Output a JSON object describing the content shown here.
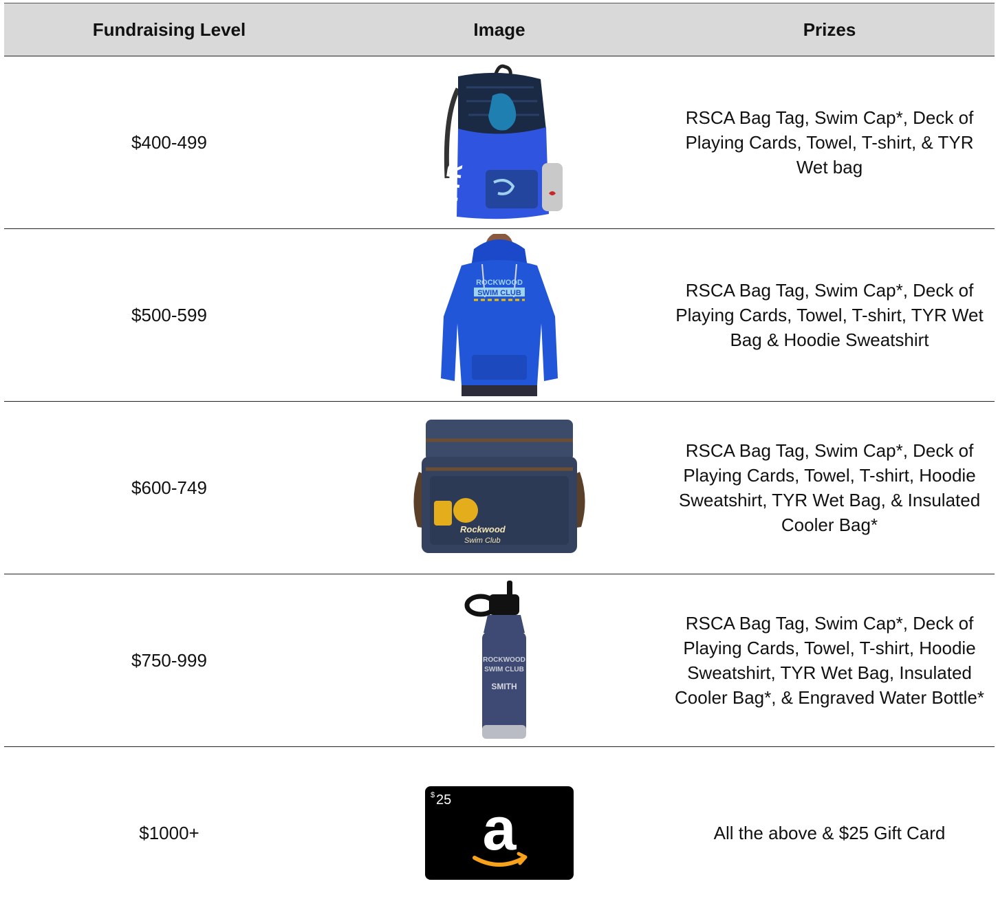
{
  "header": {
    "col_level": "Fundraising Level",
    "col_image": "Image",
    "col_prizes": "Prizes"
  },
  "rows": [
    {
      "level": "$400-499",
      "image": "tyr-mesh-backpack-icon",
      "logo": "TYR",
      "prizes": "RSCA Bag Tag, Swim Cap*, Deck of Playing Cards, Towel, T-shirt, & TYR Wet bag"
    },
    {
      "level": "$500-599",
      "image": "hoodie-sweatshirt-icon",
      "logo_line1": "ROCKWOOD",
      "logo_line2": "SWIM CLUB",
      "prizes": "RSCA Bag Tag, Swim Cap*, Deck of Playing Cards, Towel, T-shirt, TYR Wet Bag & Hoodie Sweatshirt"
    },
    {
      "level": "$600-749",
      "image": "insulated-cooler-bag-icon",
      "logo_line1": "Rockwood",
      "logo_line2": "Swim Club",
      "prizes": "RSCA Bag Tag, Swim Cap*, Deck of Playing Cards, Towel, T-shirt, Hoodie Sweatshirt, TYR Wet Bag, & Insulated Cooler Bag*"
    },
    {
      "level": "$750-999",
      "image": "engraved-water-bottle-icon",
      "logo_line1": "ROCKWOOD",
      "logo_line2": "SWIM CLUB",
      "engraving": "SMITH",
      "prizes": "RSCA Bag Tag, Swim Cap*, Deck of Playing Cards, Towel, T-shirt, Hoodie Sweatshirt, TYR Wet Bag, Insulated Cooler Bag*, & Engraved Water Bottle*"
    },
    {
      "level": "$1000+",
      "image": "amazon-gift-card-icon",
      "card_currency": "$",
      "card_amount": "25",
      "card_letter": "a",
      "prizes": "All the above & $25 Gift Card"
    }
  ]
}
